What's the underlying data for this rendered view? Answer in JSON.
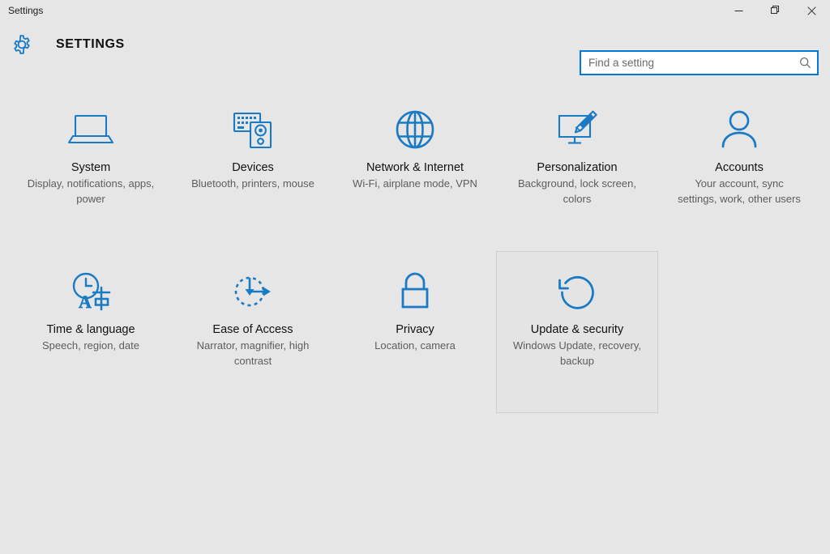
{
  "window": {
    "title": "Settings",
    "controls": [
      {
        "name": "minimize",
        "label": "Minimize"
      },
      {
        "name": "maximize",
        "label": "Restore"
      },
      {
        "name": "close",
        "label": "Close"
      }
    ]
  },
  "header": {
    "app_title": "SETTINGS",
    "gear_icon": "gear-icon"
  },
  "search": {
    "placeholder": "Find a setting",
    "value": "",
    "icon": "search-icon"
  },
  "colors": {
    "accent": "#1a7bc4",
    "page_background": "#e6e6e6",
    "search_border": "#0078d7",
    "hover_border": "#cfcfcf",
    "title_text": "#111111",
    "subtitle_text": "#5d5d5d"
  },
  "tiles": [
    {
      "id": "system",
      "icon": "laptop-icon",
      "title": "System",
      "subtitle": "Display, notifications, apps, power",
      "hovered": false
    },
    {
      "id": "devices",
      "icon": "keyboard-speaker-icon",
      "title": "Devices",
      "subtitle": "Bluetooth, printers, mouse",
      "hovered": false
    },
    {
      "id": "network-internet",
      "icon": "globe-icon",
      "title": "Network & Internet",
      "subtitle": "Wi-Fi, airplane mode, VPN",
      "hovered": false
    },
    {
      "id": "personalization",
      "icon": "monitor-paintbrush-icon",
      "title": "Personalization",
      "subtitle": "Background, lock screen, colors",
      "hovered": false
    },
    {
      "id": "accounts",
      "icon": "person-icon",
      "title": "Accounts",
      "subtitle": "Your account, sync settings, work, other users",
      "hovered": false
    },
    {
      "id": "time-language",
      "icon": "clock-language-icon",
      "title": "Time & language",
      "subtitle": "Speech, region, date",
      "hovered": false
    },
    {
      "id": "ease-of-access",
      "icon": "ease-of-access-icon",
      "title": "Ease of Access",
      "subtitle": "Narrator, magnifier, high contrast",
      "hovered": false
    },
    {
      "id": "privacy",
      "icon": "padlock-icon",
      "title": "Privacy",
      "subtitle": "Location, camera",
      "hovered": false
    },
    {
      "id": "update-security",
      "icon": "refresh-circle-icon",
      "title": "Update & security",
      "subtitle": "Windows Update, recovery, backup",
      "hovered": true
    }
  ]
}
